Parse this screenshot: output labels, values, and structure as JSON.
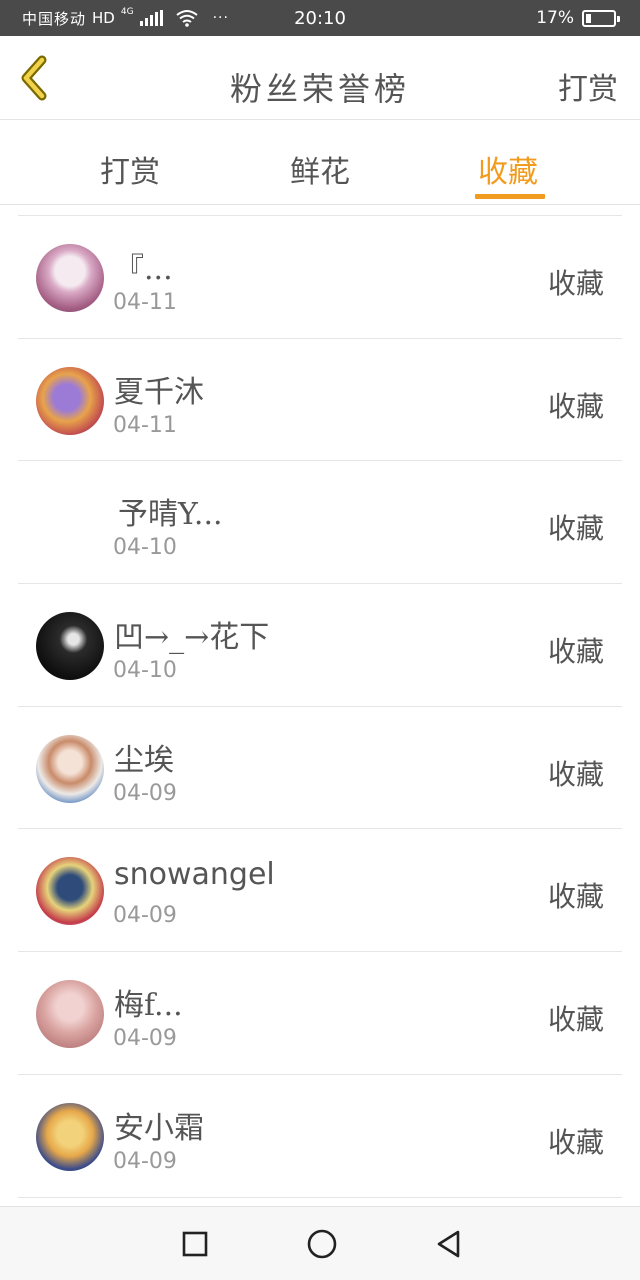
{
  "status_bar": {
    "carrier": "中国移动",
    "network": "HD",
    "network_type": "4G",
    "dots": "···",
    "time": "20:10",
    "battery": "17%"
  },
  "header": {
    "title": "粉丝荣誉榜",
    "right_action": "打赏",
    "back_icon": "chevron-left-icon",
    "accent_color": "#f29c1f"
  },
  "tabs": [
    {
      "label": "打赏",
      "active": false
    },
    {
      "label": "鲜花",
      "active": false
    },
    {
      "label": "收藏",
      "active": true
    }
  ],
  "list": [
    {
      "name": "『...",
      "date": "04-11",
      "action": "收藏"
    },
    {
      "name": "夏千沐",
      "date": "04-11",
      "action": "收藏"
    },
    {
      "name": "予晴Y...",
      "date": "04-10",
      "action": "收藏"
    },
    {
      "name": "凹→_→花下",
      "date": "04-10",
      "action": "收藏"
    },
    {
      "name": "尘埃",
      "date": "04-09",
      "action": "收藏"
    },
    {
      "name": "snowangel",
      "date": "04-09",
      "action": "收藏"
    },
    {
      "name": "梅f...",
      "date": "04-09",
      "action": "收藏"
    },
    {
      "name": "安小霜",
      "date": "04-09",
      "action": "收藏"
    }
  ],
  "nav_bar": {
    "icons": [
      "recent-apps-icon",
      "home-icon",
      "back-icon"
    ]
  }
}
